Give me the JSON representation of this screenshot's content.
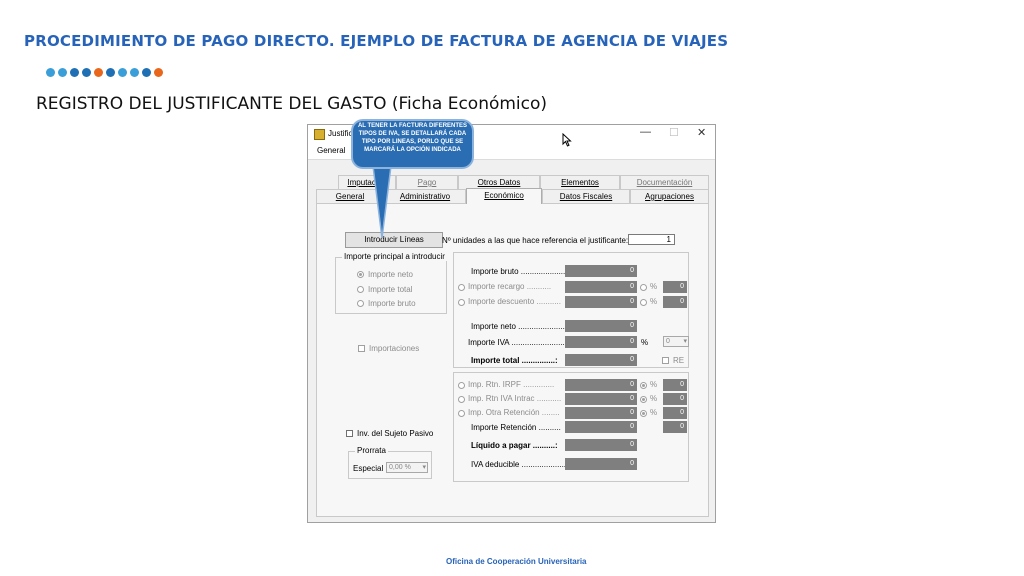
{
  "slide": {
    "title": "PROCEDIMIENTO DE PAGO DIRECTO. EJEMPLO DE FACTURA DE AGENCIA DE VIAJES",
    "subtitle": "REGISTRO DEL JUSTIFICANTE DEL GASTO (Ficha Económico)",
    "footer": "Oficina de Cooperación Universitaria",
    "dot_colors": [
      "#3a9fd8",
      "#3a9fd8",
      "#1f6fb5",
      "#1f6fb5",
      "#e8671c",
      "#1f6fb5",
      "#3a9fd8",
      "#3a9fd8",
      "#1f6fb5",
      "#e8671c"
    ]
  },
  "callout": {
    "text": "AL TENER LA FACTURA DIFERENTES TIPOS DE IVA, SE DETALLARÁ CADA TIPO POR LINEAS, PORLO QUE SE MARCARÁ LA OPCIÓN INDICADA",
    "color": "#2b6db3"
  },
  "window": {
    "title": "Justificante",
    "controls": {
      "minimize": "—",
      "maximize": "☐",
      "close": "✕"
    },
    "menu": {
      "general": "General"
    },
    "tabs_row1": [
      {
        "label": "Imputación",
        "state": "normal"
      },
      {
        "label": "Pago",
        "state": "disabled"
      },
      {
        "label": "Otros Datos",
        "state": "normal"
      },
      {
        "label": "Elementos",
        "state": "normal"
      },
      {
        "label": "Documentación",
        "state": "disabled"
      }
    ],
    "tabs_row2": [
      {
        "label": "General",
        "state": "normal"
      },
      {
        "label": "Administrativo",
        "state": "normal"
      },
      {
        "label": "Económico",
        "state": "active"
      },
      {
        "label": "Datos Fiscales",
        "state": "normal"
      },
      {
        "label": "Agrupaciones",
        "state": "normal"
      }
    ]
  },
  "form": {
    "introducir_lineas": "Introducir Líneas",
    "unidades_label": "Nº unidades a las que hace referencia el justificante:",
    "unidades_value": "1",
    "importe_principal": {
      "title": "Importe principal a introducir",
      "options": [
        "Importe neto",
        "Importe total",
        "Importe bruto"
      ],
      "selected": "Importe neto"
    },
    "importaciones": "Importaciones",
    "inv_sujeto_pasivo": "Inv. del Sujeto Pasivo",
    "prorrata": {
      "title": "Prorrata",
      "especial_label": "Especial",
      "especial_value": "0,00 %"
    },
    "fields": {
      "importe_bruto": {
        "label": "Importe bruto ....................",
        "value": "0"
      },
      "importe_recargo": {
        "label": "Importe recargo ...........",
        "value": "0",
        "pct": "0",
        "pct_symbol": "%"
      },
      "importe_descuento": {
        "label": "Importe descuento ...........",
        "value": "0",
        "pct": "0",
        "pct_symbol": "%"
      },
      "importe_neto": {
        "label": "Importe neto ......................",
        "value": "0"
      },
      "importe_iva": {
        "label": "Importe IVA ........................",
        "value": "0",
        "pct_symbol": "%",
        "iva_option": "0"
      },
      "importe_total": {
        "label": "Importe total ...............:",
        "value": "0",
        "re_label": "RE"
      },
      "imp_rtn_irpf": {
        "label": "Imp. Rtn. IRPF ..............",
        "value": "0",
        "pct": "0",
        "pct_symbol": "%"
      },
      "imp_rtn_iva_intrac": {
        "label": "Imp. Rtn IVA Intrac ...........",
        "value": "0",
        "pct": "0",
        "pct_symbol": "%"
      },
      "imp_otra_retencion": {
        "label": "Imp. Otra Retención ........",
        "value": "0",
        "pct": "0",
        "pct_symbol": "%"
      },
      "importe_retencion": {
        "label": "Importe Retención ..........",
        "value": "0",
        "value2": "0"
      },
      "liquido_pagar": {
        "label": "Líquido a pagar ..........:",
        "value": "0"
      },
      "iva_deducible": {
        "label": "IVA deducible ....................",
        "value": "0"
      }
    }
  }
}
